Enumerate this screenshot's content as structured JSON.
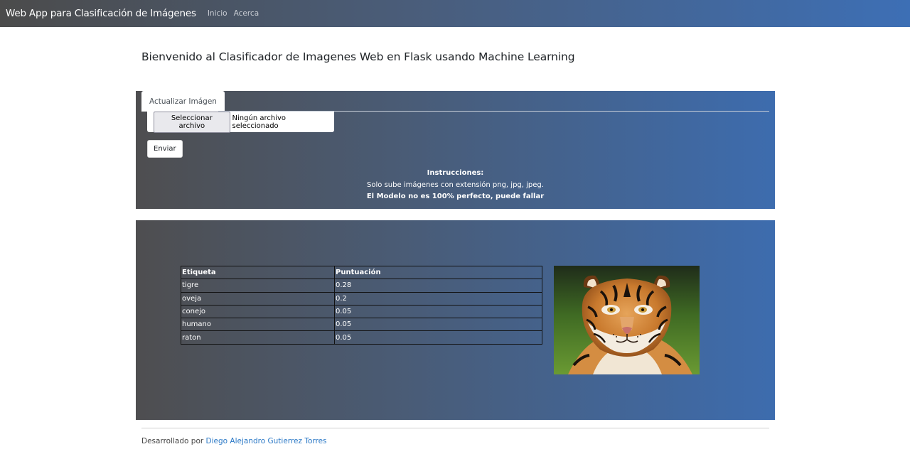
{
  "navbar": {
    "brand": "Web App para Clasificación de Imágenes",
    "links": [
      "Inicio",
      "Acerca"
    ]
  },
  "main": {
    "title": "Bienvenido al Clasificador de Imagenes Web en Flask usando Machine Learning"
  },
  "upload": {
    "tab_label": "Actualizar Imágen",
    "file_button": "Seleccionar archivo",
    "file_status": "Ningún archivo seleccionado",
    "submit_label": "Enviar",
    "instructions_title": "Instrucciones:",
    "instructions_line1": "Solo sube imágenes con extensión png, jpg, jpeg.",
    "instructions_line2": "El Modelo no es 100% perfecto, puede fallar"
  },
  "results": {
    "headers": [
      "Etiqueta",
      "Puntuación"
    ],
    "rows": [
      {
        "label": "tigre",
        "score": "0.28"
      },
      {
        "label": "oveja",
        "score": "0.2"
      },
      {
        "label": "conejo",
        "score": "0.05"
      },
      {
        "label": "humano",
        "score": "0.05"
      },
      {
        "label": "raton",
        "score": "0.05"
      }
    ],
    "image_icon": "tiger-photo"
  },
  "footer": {
    "prefix": "Desarrollado por",
    "author": "Diego Alejandro Gutierrez Torres"
  },
  "colors": {
    "gradient_start": "#4e4e50",
    "gradient_end": "#3d6cae",
    "link": "#2a78c6"
  }
}
